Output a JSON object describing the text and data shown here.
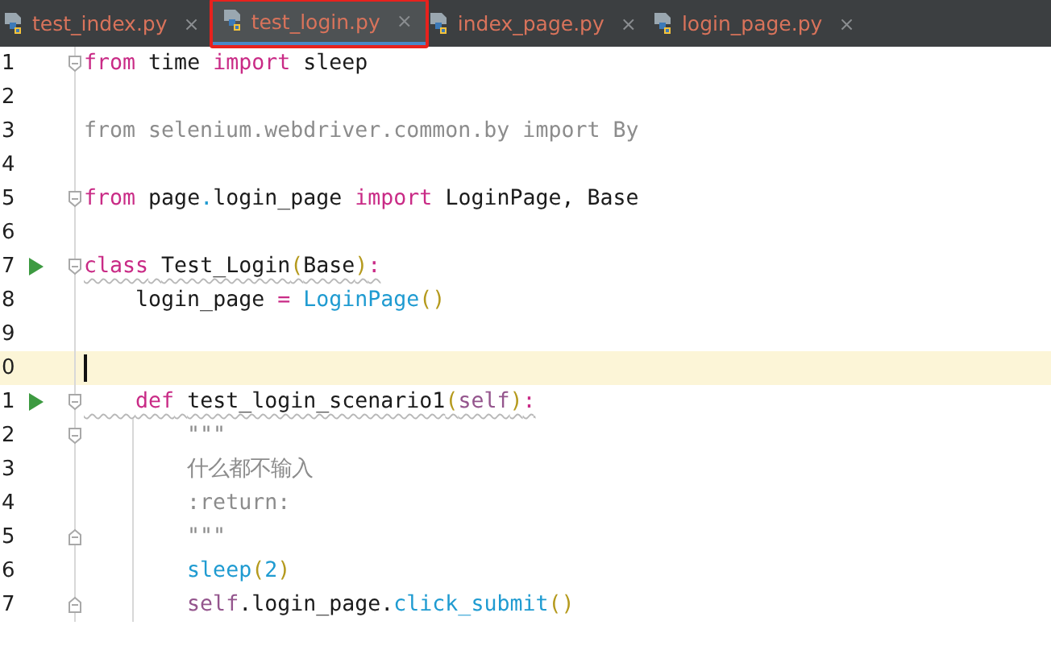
{
  "tabs": [
    {
      "label": "test_index.py",
      "close": "×",
      "selected": false,
      "outlined": false
    },
    {
      "label": "test_login.py",
      "close": "×",
      "selected": true,
      "outlined": true
    },
    {
      "label": "index_page.py",
      "close": "×",
      "selected": false,
      "outlined": false
    },
    {
      "label": "login_page.py",
      "close": "×",
      "selected": false,
      "outlined": false
    }
  ],
  "lines": [
    {
      "number": "1",
      "run": false,
      "fold_open": true,
      "fold_close": false,
      "current": false,
      "caret": false,
      "warning": false,
      "tokens": [
        {
          "kind": "kw",
          "text": "from"
        },
        {
          "kind": "plain",
          "text": " time "
        },
        {
          "kind": "kw",
          "text": "import"
        },
        {
          "kind": "plain",
          "text": " sleep"
        }
      ]
    },
    {
      "number": "2",
      "run": false,
      "fold_open": false,
      "fold_close": false,
      "current": false,
      "caret": false,
      "warning": false
    },
    {
      "number": "3",
      "run": false,
      "fold_open": false,
      "fold_close": false,
      "current": false,
      "caret": false,
      "warning": false,
      "tokens": [
        {
          "kind": "dim",
          "text": "from selenium.webdriver.common.by import By"
        }
      ]
    },
    {
      "number": "4",
      "run": false,
      "fold_open": false,
      "fold_close": false,
      "current": false,
      "caret": false,
      "warning": false
    },
    {
      "number": "5",
      "run": false,
      "fold_open": true,
      "fold_close": false,
      "current": false,
      "caret": false,
      "warning": false,
      "tokens": [
        {
          "kind": "kw",
          "text": "from"
        },
        {
          "kind": "plain",
          "text": " page"
        },
        {
          "kind": "call",
          "text": "."
        },
        {
          "kind": "plain",
          "text": "login_page "
        },
        {
          "kind": "kw",
          "text": "import"
        },
        {
          "kind": "plain",
          "text": " LoginPage, Base"
        }
      ]
    },
    {
      "number": "6",
      "run": false,
      "fold_open": false,
      "fold_close": false,
      "current": false,
      "caret": false,
      "warning": false
    },
    {
      "number": "7",
      "run": true,
      "fold_open": true,
      "fold_close": false,
      "current": false,
      "caret": false,
      "warning": true,
      "tokens": [
        {
          "kind": "kw",
          "text": "class"
        },
        {
          "kind": "plain",
          "text": " Test_Login"
        },
        {
          "kind": "paren",
          "text": "("
        },
        {
          "kind": "plain",
          "text": "Base"
        },
        {
          "kind": "paren",
          "text": ")"
        },
        {
          "kind": "kw",
          "text": ":"
        }
      ]
    },
    {
      "number": "8",
      "run": false,
      "fold_open": false,
      "fold_close": false,
      "current": false,
      "caret": false,
      "warning": false,
      "tokens": [
        {
          "kind": "plain",
          "text": "    login_page "
        },
        {
          "kind": "kw",
          "text": "= "
        },
        {
          "kind": "call",
          "text": "LoginPage"
        },
        {
          "kind": "paren",
          "text": "()"
        }
      ]
    },
    {
      "number": "9",
      "run": false,
      "fold_open": false,
      "fold_close": false,
      "current": false,
      "caret": false,
      "warning": false
    },
    {
      "number": "0",
      "run": false,
      "fold_open": false,
      "fold_close": false,
      "current": true,
      "caret": true,
      "warning": false
    },
    {
      "number": "1",
      "run": true,
      "fold_open": true,
      "fold_close": false,
      "current": false,
      "caret": false,
      "warning": true,
      "tokens": [
        {
          "kind": "kw",
          "text": "    def"
        },
        {
          "kind": "plain",
          "text": " test_login_scenario1"
        },
        {
          "kind": "paren",
          "text": "("
        },
        {
          "kind": "self",
          "text": "self"
        },
        {
          "kind": "paren",
          "text": ")"
        },
        {
          "kind": "kw",
          "text": ":"
        }
      ]
    },
    {
      "number": "2",
      "run": false,
      "fold_open": true,
      "fold_close": false,
      "current": false,
      "caret": false,
      "warning": false,
      "tokens": [
        {
          "kind": "dim",
          "text": "        \"\"\""
        }
      ]
    },
    {
      "number": "3",
      "run": false,
      "fold_open": false,
      "fold_close": false,
      "current": false,
      "caret": false,
      "warning": false,
      "tokens": [
        {
          "kind": "dim",
          "text": "        什么都不输入"
        }
      ]
    },
    {
      "number": "4",
      "run": false,
      "fold_open": false,
      "fold_close": false,
      "current": false,
      "caret": false,
      "warning": false,
      "tokens": [
        {
          "kind": "dim",
          "text": "        :return:"
        }
      ]
    },
    {
      "number": "5",
      "run": false,
      "fold_open": false,
      "fold_close": true,
      "current": false,
      "caret": false,
      "warning": false,
      "tokens": [
        {
          "kind": "dim",
          "text": "        \"\"\""
        }
      ]
    },
    {
      "number": "6",
      "run": false,
      "fold_open": false,
      "fold_close": false,
      "current": false,
      "caret": false,
      "warning": false,
      "tokens": [
        {
          "kind": "call",
          "text": "        sleep"
        },
        {
          "kind": "paren",
          "text": "("
        },
        {
          "kind": "call",
          "text": "2"
        },
        {
          "kind": "paren",
          "text": ")"
        }
      ]
    },
    {
      "number": "7",
      "run": false,
      "fold_open": false,
      "fold_close": true,
      "current": false,
      "caret": false,
      "warning": false,
      "tokens": [
        {
          "kind": "self",
          "text": "        self"
        },
        {
          "kind": "plain",
          "text": ".login_page."
        },
        {
          "kind": "call",
          "text": "click_submit"
        },
        {
          "kind": "paren",
          "text": "()"
        }
      ]
    }
  ]
}
